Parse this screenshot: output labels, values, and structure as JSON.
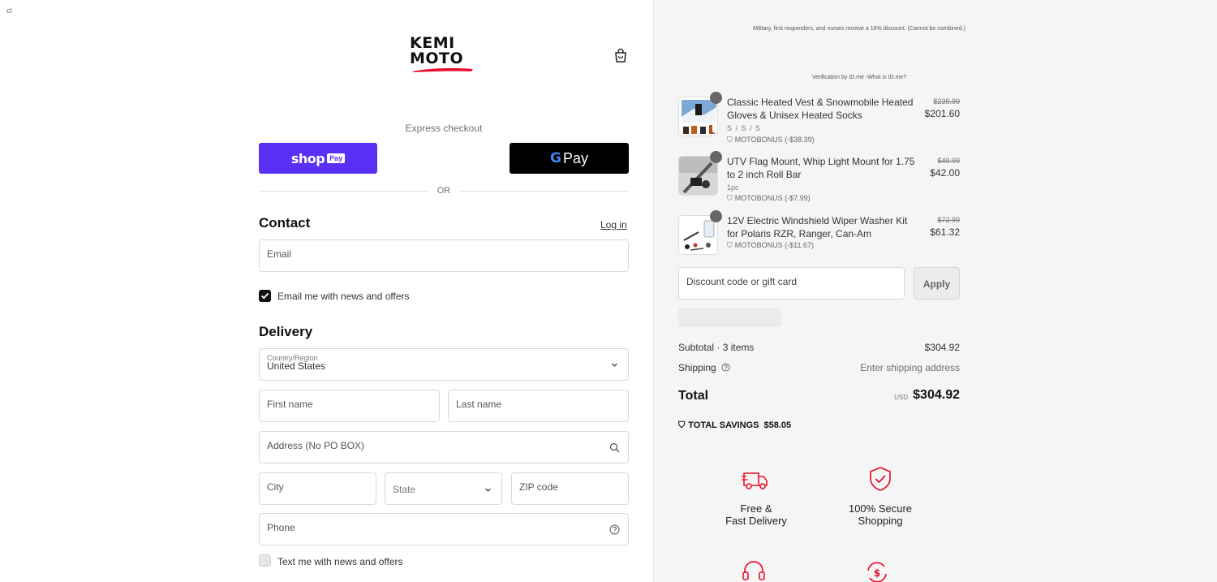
{
  "corner_mark": "cl",
  "brand": {
    "line1": "KEMI",
    "line2": "MOTO",
    "accent": "#e8112d"
  },
  "express": {
    "label": "Express checkout",
    "shop_pay": {
      "shop": "shop",
      "pay": "Pay"
    },
    "gpay": {
      "g": "G",
      "pay": "Pay"
    },
    "or": "OR"
  },
  "contact": {
    "title": "Contact",
    "login": "Log in",
    "email_placeholder": "Email",
    "newsletter_label": "Email me with news and offers",
    "newsletter_checked": true
  },
  "delivery": {
    "title": "Delivery",
    "country_label": "Country/Region",
    "country_value": "United States",
    "first_name": "First name",
    "last_name": "Last name",
    "address": "Address (No PO BOX)",
    "city": "City",
    "state": "State",
    "zip": "ZIP code",
    "phone": "Phone",
    "sms_label": "Text me with news and offers",
    "sms_checked": false
  },
  "summary": {
    "promo": "Military, first responders, and nurses receive a 16% discount. (Cannot be combined.)",
    "verification": "Verification by ID.me -What is ID.me?",
    "items": [
      {
        "name": "Classic Heated Vest & Snowmobile Heated Gloves & Unisex Heated Socks",
        "variant": "S / S / S",
        "discount": "MOTOBONUS (-$38.39)",
        "old_price": "$239.99",
        "price": "$201.60"
      },
      {
        "name": "UTV Flag Mount, Whip Light Mount for 1.75 to 2 inch Roll Bar",
        "variant": "1pc",
        "discount": "MOTOBONUS (-$7.99)",
        "old_price": "$49.99",
        "price": "$42.00"
      },
      {
        "name": "12V Electric Windshield Wiper Washer Kit for Polaris RZR, Ranger, Can-Am",
        "variant": "",
        "discount": "MOTOBONUS (-$11.67)",
        "old_price": "$72.99",
        "price": "$61.32"
      }
    ],
    "discount_placeholder": "Discount code or gift card",
    "apply": "Apply",
    "subtotal_label": "Subtotal · 3 items",
    "subtotal_value": "$304.92",
    "shipping_label": "Shipping",
    "shipping_value": "Enter shipping address",
    "total_label": "Total",
    "currency": "USD",
    "total_value": "$304.92",
    "savings_label": "TOTAL SAVINGS",
    "savings_value": "$58.05",
    "features": [
      {
        "line1": "Free &",
        "line2": "Fast Delivery",
        "icon": "truck-icon"
      },
      {
        "line1": "100% Secure",
        "line2": "Shopping",
        "icon": "shield-check-icon"
      }
    ]
  },
  "colors": {
    "shop_pay": "#5a31f4",
    "gpay": "#000000",
    "accent": "#e8112d"
  }
}
